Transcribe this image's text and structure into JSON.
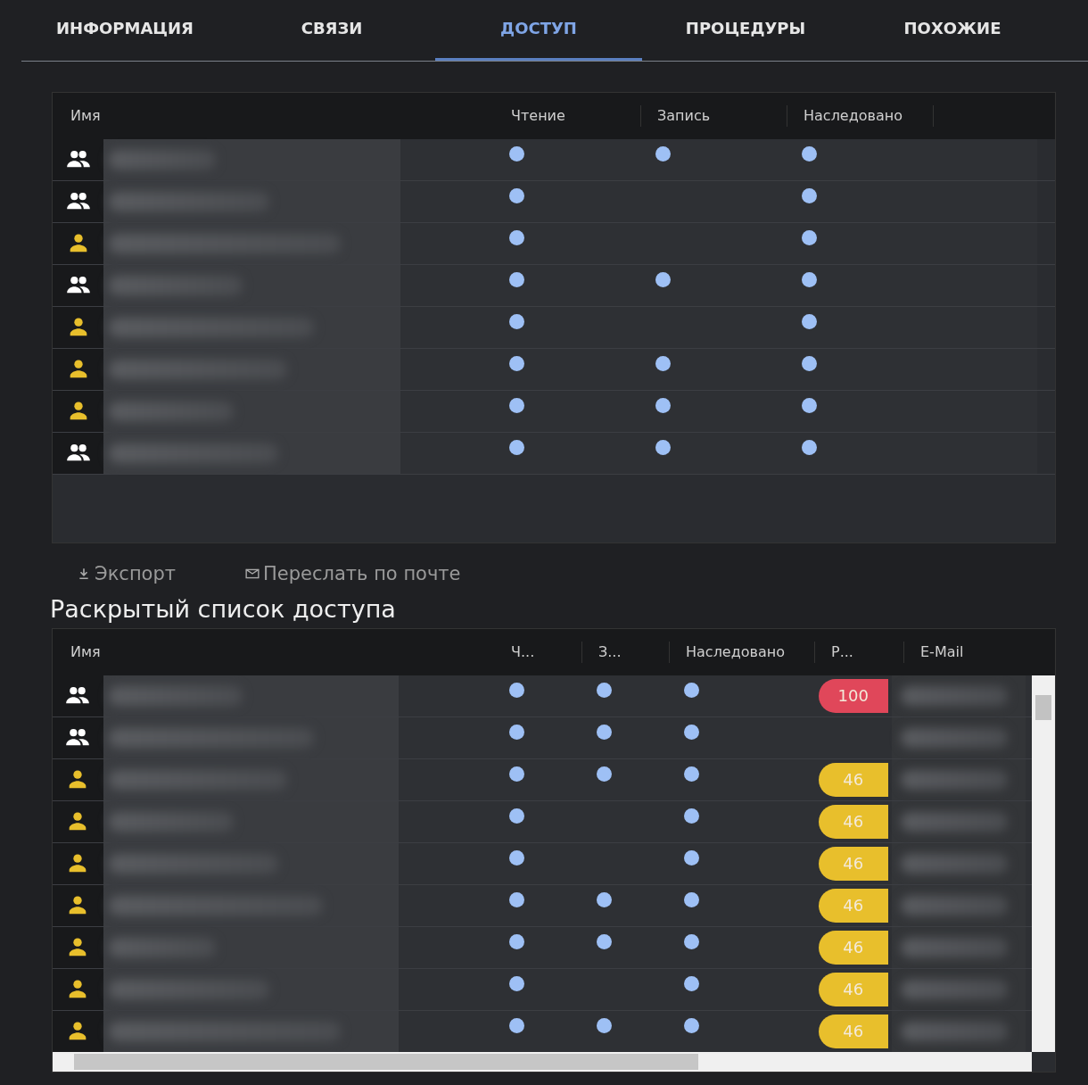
{
  "tabs": [
    {
      "label": "ИНФОРМАЦИЯ",
      "selected": false
    },
    {
      "label": "СВЯЗИ",
      "selected": false
    },
    {
      "label": "ДОСТУП",
      "selected": true
    },
    {
      "label": "ПРОЦЕДУРЫ",
      "selected": false
    },
    {
      "label": "ПОХОЖИЕ",
      "selected": false
    }
  ],
  "access_table": {
    "columns": [
      "Имя",
      "Чтение",
      "Запись",
      "Наследовано"
    ],
    "rows": [
      {
        "kind": "group",
        "read": true,
        "write": true,
        "inherited": true
      },
      {
        "kind": "group",
        "read": true,
        "write": false,
        "inherited": true
      },
      {
        "kind": "user",
        "read": true,
        "write": false,
        "inherited": true
      },
      {
        "kind": "group",
        "read": true,
        "write": true,
        "inherited": true
      },
      {
        "kind": "user",
        "read": true,
        "write": false,
        "inherited": true
      },
      {
        "kind": "user",
        "read": true,
        "write": true,
        "inherited": true
      },
      {
        "kind": "user",
        "read": true,
        "write": true,
        "inherited": true
      },
      {
        "kind": "group",
        "read": true,
        "write": true,
        "inherited": true
      }
    ]
  },
  "actions": [
    {
      "kind": "export",
      "label": "Экспорт"
    },
    {
      "kind": "mail",
      "label": "Переслать по почте"
    }
  ],
  "expanded_title": "Раскрытый список доступа",
  "expanded_table": {
    "columns": [
      "Имя",
      "Ч...",
      "З...",
      "Наследовано",
      "Р...",
      "E-Mail"
    ],
    "rows": [
      {
        "kind": "group",
        "read": true,
        "write": true,
        "inherited": true,
        "badge": "100",
        "color": "#e0475a"
      },
      {
        "kind": "group",
        "read": true,
        "write": true,
        "inherited": true
      },
      {
        "kind": "user",
        "read": true,
        "write": true,
        "inherited": true,
        "badge": "46",
        "color": "#e8bf2c"
      },
      {
        "kind": "user",
        "read": true,
        "write": false,
        "inherited": true,
        "badge": "46",
        "color": "#e8bf2c"
      },
      {
        "kind": "user",
        "read": true,
        "write": false,
        "inherited": true,
        "badge": "46",
        "color": "#e8bf2c"
      },
      {
        "kind": "user",
        "read": true,
        "write": true,
        "inherited": true,
        "badge": "46",
        "color": "#e8bf2c"
      },
      {
        "kind": "user",
        "read": true,
        "write": true,
        "inherited": true,
        "badge": "46",
        "color": "#e8bf2c"
      },
      {
        "kind": "user",
        "read": true,
        "write": false,
        "inherited": true,
        "badge": "46",
        "color": "#e8bf2c"
      },
      {
        "kind": "user",
        "read": true,
        "write": true,
        "inherited": true,
        "badge": "46",
        "color": "#e8bf2c"
      }
    ]
  }
}
